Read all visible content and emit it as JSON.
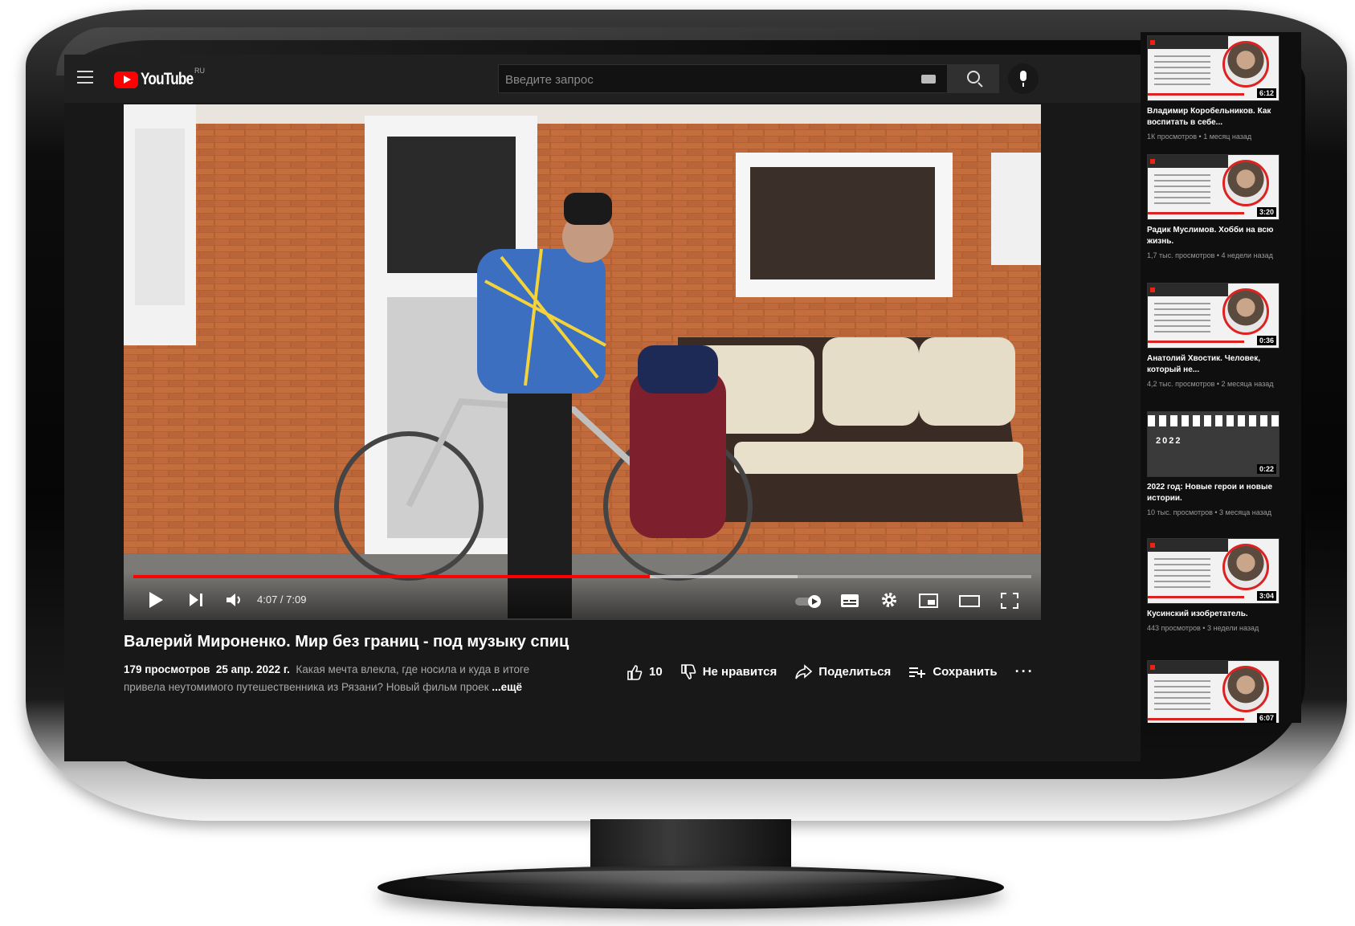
{
  "header": {
    "logo_text": "YouTube",
    "region": "RU",
    "search_placeholder": "Введите запрос"
  },
  "player": {
    "time": "4:07 / 7:09",
    "progress_fraction": 0.575,
    "buffered_fraction": 0.74,
    "progress_color": "#ff0000"
  },
  "video": {
    "title": "Валерий Мироненко. Мир без границ - под музыку спиц",
    "views": "179 просмотров",
    "date": "25 апр. 2022 г.",
    "description": "Какая мечта влекла, где носила и куда в итоге привела неутомимого путешественника из Рязани? Новый фильм проек",
    "more": "...ещё"
  },
  "actions": {
    "likes": "10",
    "dislike": "Не нравится",
    "share": "Поделиться",
    "save": "Сохранить",
    "more": "···"
  },
  "recommendations": [
    {
      "title": "Владимир Коробельников. Как воспитать в себе...",
      "meta": "1К просмотров • 1 месяц назад",
      "duration": "6:12"
    },
    {
      "title": "Радик Муслимов. Хобби на всю жизнь.",
      "meta": "1,7 тыс. просмотров • 4 недели назад",
      "duration": "3:20"
    },
    {
      "title": "Анатолий Хвостик. Человек, который не...",
      "meta": "4,2 тыс. просмотров • 2 месяца назад",
      "duration": "0:36"
    },
    {
      "title": "2022 год: Новые герои и новые истории.",
      "meta": "10 тыс. просмотров • 3 месяца назад",
      "duration": "0:22",
      "year": "2022"
    },
    {
      "title": "Кусинский изобретатель.",
      "meta": "443 просмотров • 3 недели назад",
      "duration": "3:04"
    },
    {
      "title": "",
      "meta": "",
      "duration": "6:07"
    }
  ]
}
